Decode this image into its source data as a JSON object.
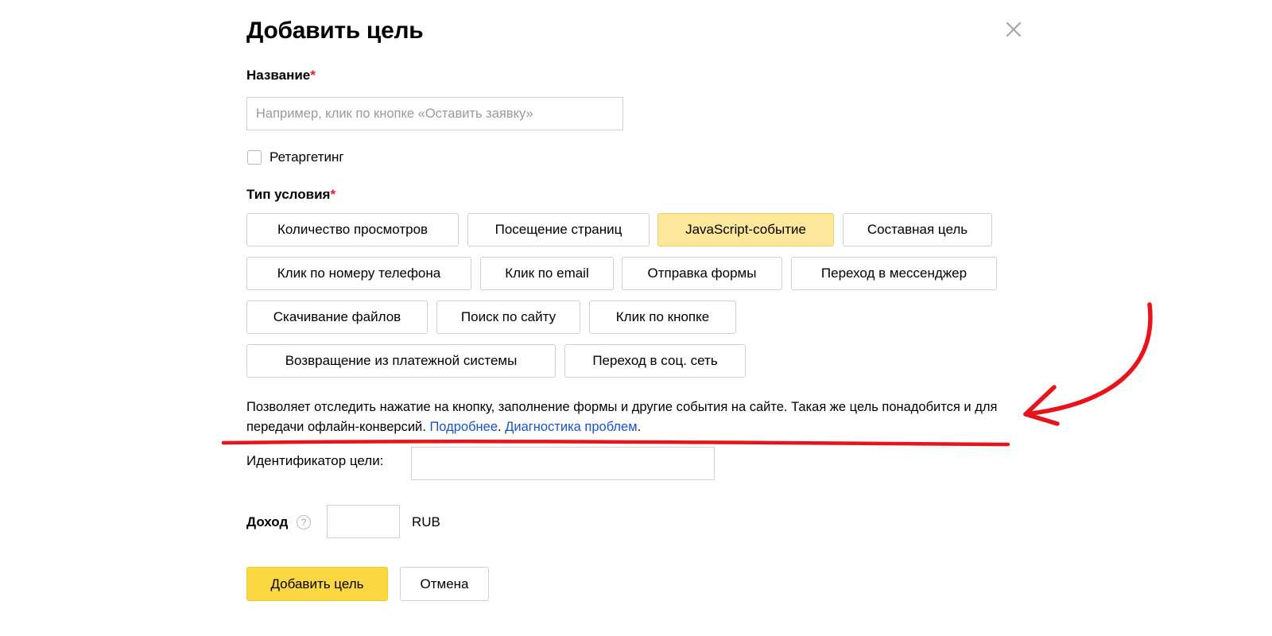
{
  "dialog": {
    "title": "Добавить цель",
    "close_icon": "close-icon"
  },
  "name_field": {
    "label": "Название",
    "required_mark": "*",
    "placeholder": "Например, клик по кнопке «Оставить заявку»",
    "value": ""
  },
  "retargeting": {
    "label": "Ретаргетинг",
    "checked": false
  },
  "condition_type": {
    "label": "Тип условия",
    "required_mark": "*",
    "options": [
      "Количество просмотров",
      "Посещение страниц",
      "JavaScript-событие",
      "Составная цель",
      "Клик по номеру телефона",
      "Клик по email",
      "Отправка формы",
      "Переход в мессенджер",
      "Скачивание файлов",
      "Поиск по сайту",
      "Клик по кнопке",
      "Возвращение из платежной системы",
      "Переход в соц. сеть"
    ],
    "selected": "JavaScript-событие",
    "selected_color": "#fde79b"
  },
  "description": {
    "text": "Позволяет отследить нажатие на кнопку, заполнение формы и другие события на сайте. Такая же цель понадобится и для передачи офлайн-конверсий. ",
    "link_more": "Подробнее",
    "separator": ". ",
    "link_diagnostics": "Диагностика проблем",
    "end": ".",
    "link_color": "#1a52c5"
  },
  "goal_id": {
    "label": "Идентификатор цели:",
    "value": ""
  },
  "income": {
    "label": "Доход",
    "help_icon": "question-icon",
    "help_glyph": "?",
    "value": "",
    "currency": "RUB"
  },
  "buttons": {
    "submit": "Добавить цель",
    "cancel": "Отмена",
    "submit_color": "#fbd741"
  },
  "annotation": {
    "arrow_color": "#e8141c",
    "underline_color": "#e8141c"
  }
}
